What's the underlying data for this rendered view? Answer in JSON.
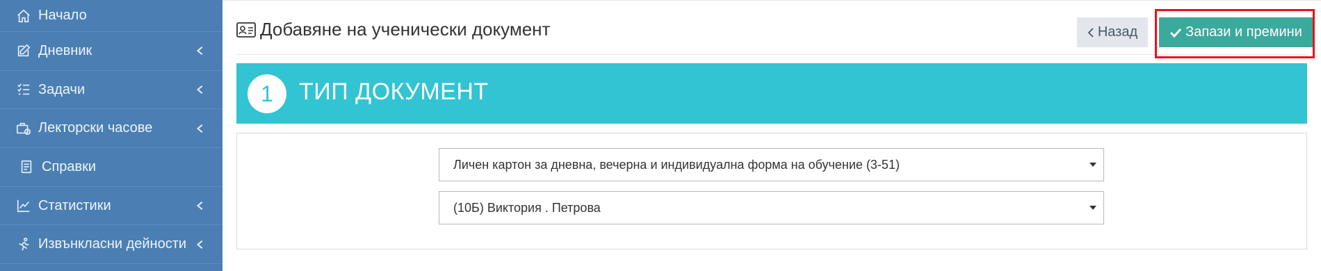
{
  "sidebar": {
    "items": [
      {
        "label": "Начало",
        "icon": "home-icon",
        "has_chevron": false
      },
      {
        "label": "Дневник",
        "icon": "edit-icon",
        "has_chevron": true
      },
      {
        "label": "Задачи",
        "icon": "task-list-icon",
        "has_chevron": true
      },
      {
        "label": "Лекторски часове",
        "icon": "briefcase-clock-icon",
        "has_chevron": true
      },
      {
        "label": "Справки",
        "icon": "document-icon",
        "has_chevron": false
      },
      {
        "label": "Статистики",
        "icon": "chart-icon",
        "has_chevron": true
      },
      {
        "label": "Извънкласни дейности",
        "icon": "running-icon",
        "has_chevron": true
      }
    ]
  },
  "header": {
    "title": "Добавяне на ученически документ",
    "title_icon": "id-card-icon",
    "back_label": "Назад",
    "save_label": "Запази и премини"
  },
  "step": {
    "number": "1",
    "title": "ТИП ДОКУМЕНТ"
  },
  "form": {
    "document_type": "Личен картон за дневна, вечерна и индивидуална форма на обучение (3-51)",
    "student": "(10Б) Виктория . Петрова"
  },
  "colors": {
    "sidebar": "#4b7fb3",
    "banner": "#33c4d3",
    "save_button": "#3ba99c",
    "highlight": "#e8121a"
  }
}
